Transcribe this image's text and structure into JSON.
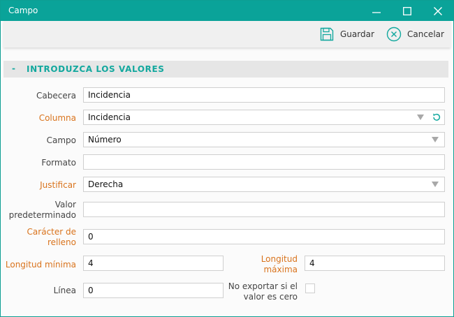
{
  "window": {
    "title": "Campo"
  },
  "toolbar": {
    "save_label": "Guardar",
    "cancel_label": "Cancelar"
  },
  "section": {
    "toggle": "-",
    "title": "INTRODUZCA LOS VALORES"
  },
  "form": {
    "cabecera": {
      "label": "Cabecera",
      "value": "Incidencia"
    },
    "columna": {
      "label": "Columna",
      "value": "Incidencia"
    },
    "campo": {
      "label": "Campo",
      "value": "Número"
    },
    "formato": {
      "label": "Formato",
      "value": ""
    },
    "justificar": {
      "label": "Justificar",
      "value": "Derecha"
    },
    "valor_predeterminado": {
      "label_line1": "Valor",
      "label_line2": "predeterminado",
      "value": ""
    },
    "caracter_relleno": {
      "label_line1": "Carácter de",
      "label_line2": "relleno",
      "value": "0"
    },
    "longitud_minima": {
      "label": "Longitud mínima",
      "value": "4"
    },
    "longitud_maxima": {
      "label_line1": "Longitud",
      "label_line2": "máxima",
      "value": "4"
    },
    "linea": {
      "label": "Línea",
      "value": "0"
    },
    "no_exportar": {
      "label_line1": "No exportar si el",
      "label_line2": "valor es cero",
      "checked": false
    }
  },
  "colors": {
    "accent": "#0aa399",
    "required_label": "#d9731c"
  }
}
